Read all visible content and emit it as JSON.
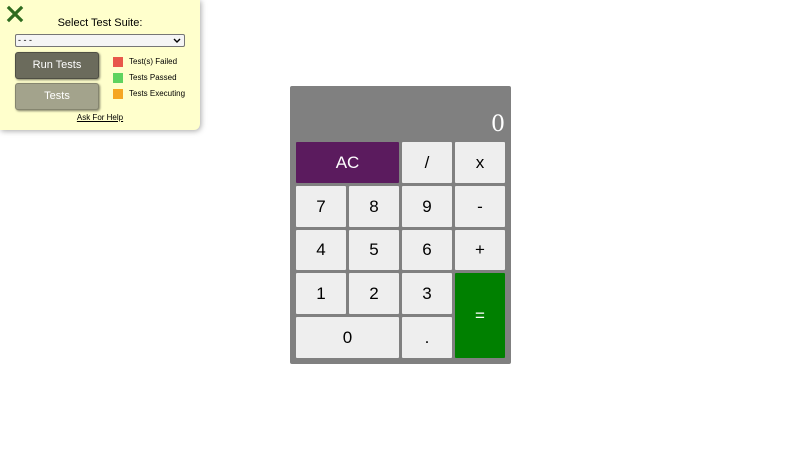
{
  "test_panel": {
    "title": "Select Test Suite:",
    "suite_select": {
      "selected": "- - -"
    },
    "run_button_label": "Run Tests",
    "tests_button_label": "Tests",
    "legend": [
      {
        "label": "Test(s) Failed",
        "color": "#e8574a"
      },
      {
        "label": "Tests Passed",
        "color": "#5fd35f"
      },
      {
        "label": "Tests Executing",
        "color": "#f5a623"
      }
    ],
    "help_link": "Ask For Help",
    "close_icon": "close-x-icon",
    "accent_color": "#2e6b1f"
  },
  "calculator": {
    "display": "0",
    "keys": {
      "clear": "AC",
      "divide": "/",
      "multiply": "x",
      "seven": "7",
      "eight": "8",
      "nine": "9",
      "subtract": "-",
      "four": "4",
      "five": "5",
      "six": "6",
      "add": "+",
      "one": "1",
      "two": "2",
      "three": "3",
      "equals": "=",
      "zero": "0",
      "decimal": "."
    },
    "colors": {
      "body": "#808080",
      "clear_key": "#5b1b5e",
      "equals_key": "#008000",
      "number_key": "#eeeeee"
    }
  }
}
